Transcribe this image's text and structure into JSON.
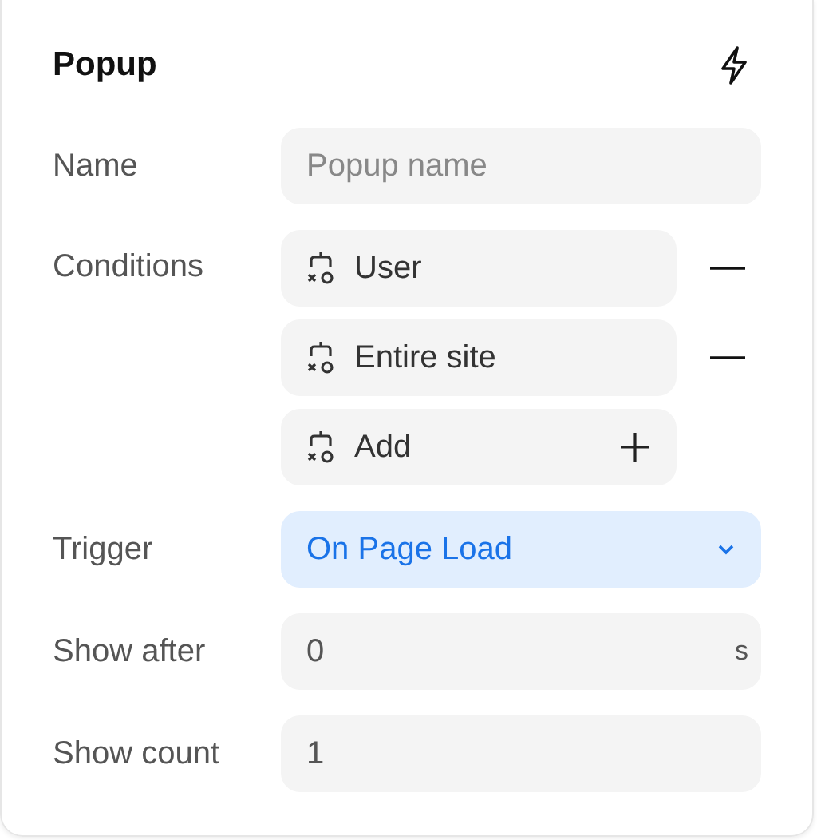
{
  "panel": {
    "title": "Popup"
  },
  "name": {
    "label": "Name",
    "placeholder": "Popup name"
  },
  "conditions": {
    "label": "Conditions",
    "items": [
      {
        "kind": "condition",
        "label": "User"
      },
      {
        "kind": "condition",
        "label": "Entire site"
      },
      {
        "kind": "add",
        "label": "Add"
      }
    ]
  },
  "trigger": {
    "label": "Trigger",
    "value": "On Page Load"
  },
  "show_after": {
    "label": "Show after",
    "value": "0",
    "unit": "s"
  },
  "show_count": {
    "label": "Show count",
    "value": "1"
  }
}
